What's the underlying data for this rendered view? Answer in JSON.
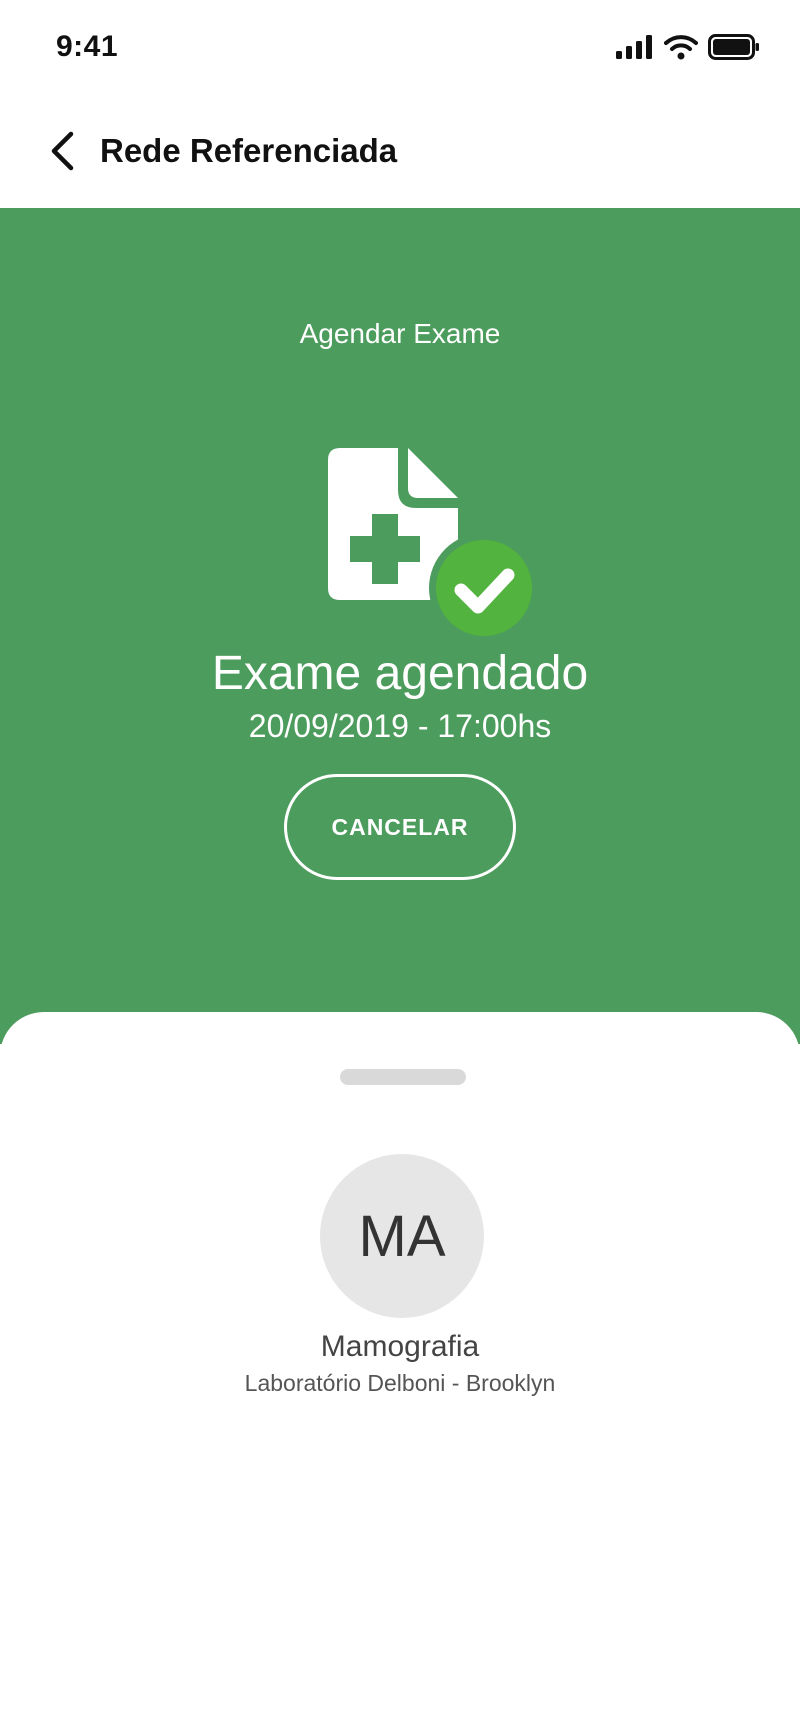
{
  "status_bar": {
    "time": "9:41"
  },
  "nav": {
    "title": "Rede Referenciada"
  },
  "hero": {
    "heading": "Agendar Exame",
    "confirmation_title": "Exame agendado",
    "datetime": "20/09/2019 - 17:00hs",
    "cancel_label": "CANCELAR",
    "accent_color": "#4c9c5d",
    "check_color": "#52b33f"
  },
  "sheet": {
    "avatar_initials": "MA",
    "exam_name": "Mamografia",
    "lab_name": "Laboratório Delboni - Brooklyn"
  }
}
